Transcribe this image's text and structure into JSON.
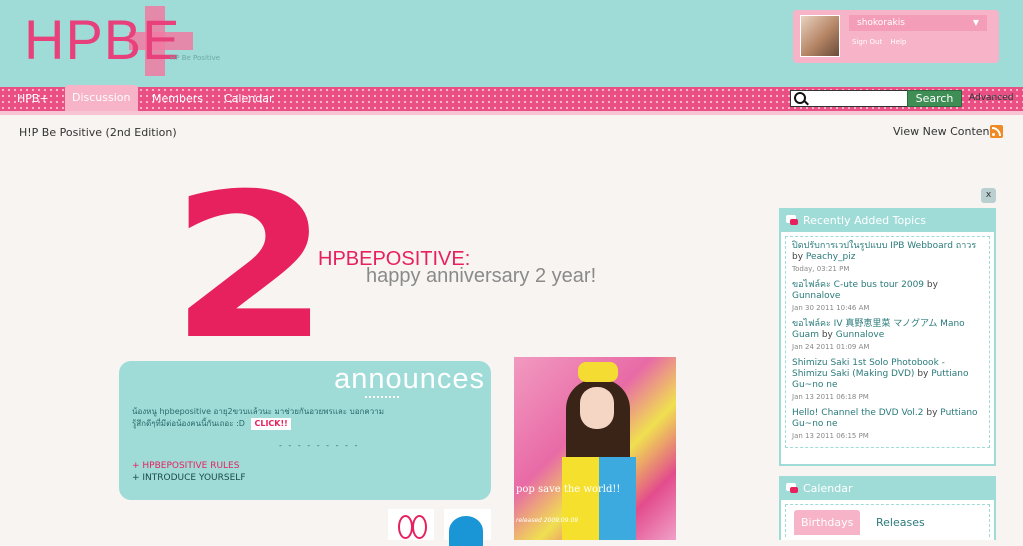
{
  "header": {
    "logo_text": "HPBE",
    "logo_tagline": "HP Be Positive",
    "user": {
      "name": "shokorakis",
      "sign_out": "Sign Out",
      "help": "Help"
    }
  },
  "nav": {
    "items": [
      "HPB+",
      "Discussion",
      "Members",
      "Calendar"
    ],
    "active": "Discussion",
    "search_button": "Search",
    "search_placeholder": "",
    "advanced": "Advanced"
  },
  "breadcrumb": "H!P Be Positive (2nd Edition)",
  "view_new": "View New Content",
  "banner": {
    "number": "2",
    "title": "HPBEPOSITIVE:",
    "subtitle": "happy anniversary 2 year!"
  },
  "announce": {
    "title": "announces",
    "text": "น้องหนู hpbepositive อายุ2ขวบแล้วนะ มาช่วยกันอวยพรและ บอกความรู้สึกดีๆที่มีต่อน้องคนนี้กันเถอะ :D",
    "click": "CLICK!!",
    "dashes": "- - - - - - - - -",
    "link1": "+ HPBEPOSITIVE RULES",
    "link2": "+ INTRODUCE YOURSELF"
  },
  "photo": {
    "caption": "pop save the world!!",
    "small": "released 2009.09.09"
  },
  "close": "x",
  "recent": {
    "title": "Recently Added Topics",
    "topics": [
      {
        "title": "ปิดปรับการเวปในรูปแบบ IPB Webboard ถาวร",
        "by": "by",
        "author": "Peachy_piz",
        "date": "Today, 03:21 PM"
      },
      {
        "title": "ขอไฟล์คะ C-ute bus tour 2009",
        "by": "by",
        "author": "Gunnalove",
        "date": "Jan 30 2011 10:46 AM"
      },
      {
        "title": "ขอไฟล์คะ IV 真野恵里菜 マノグアム Mano Guam",
        "by": "by",
        "author": "Gunnalove",
        "date": "Jan 24 2011 01:09 AM"
      },
      {
        "title": "Shimizu Saki 1st Solo Photobook - Shimizu Saki (Making DVD)",
        "by": "by",
        "author": "Puttiano Gu~no ne",
        "date": "Jan 13 2011 06:18 PM"
      },
      {
        "title": "Hello! Channel the DVD Vol.2",
        "by": "by",
        "author": "Puttiano Gu~no ne",
        "date": "Jan 13 2011 06:15 PM"
      }
    ]
  },
  "calendar": {
    "title": "Calendar",
    "tabs": [
      "Birthdays",
      "Releases"
    ]
  }
}
